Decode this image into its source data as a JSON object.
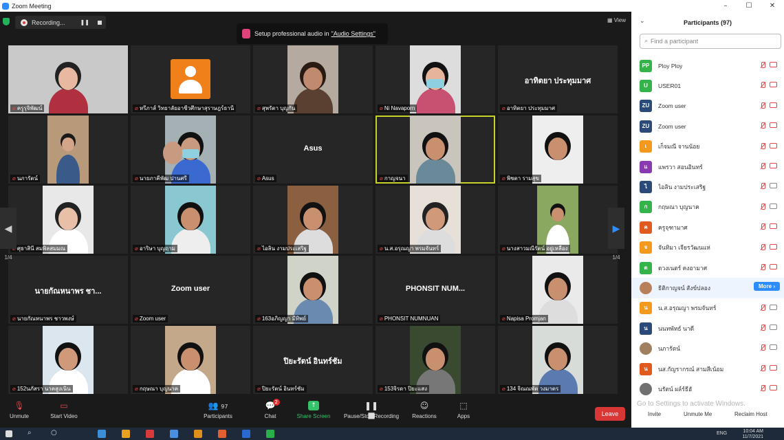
{
  "window": {
    "title": "Zoom Meeting",
    "controls": [
      "–",
      "☐",
      "✕"
    ]
  },
  "recording": {
    "label": "Recording...",
    "pause": "❚❚"
  },
  "audio_banner": {
    "text": "Setup professional audio in ",
    "link": "\"Audio Settings\""
  },
  "view_label": "View",
  "pager": {
    "left_num": "1/4",
    "right_num": "1/4"
  },
  "tiles": [
    {
      "name": "ครูรุจิพัฒน์",
      "video": "face",
      "bg": "#c9c9c9",
      "skin": "#e8b8a0",
      "hair": "#222",
      "shirt": "#b03040"
    },
    {
      "name": "หรีภาส์ วิทยาลัยอาชีวศึกษาสุราษฎร์ธานี",
      "video": "avatar"
    },
    {
      "name": "สุพรัตา บุญกัน",
      "video": "face",
      "bg": "#b5aaa0",
      "skin": "#c08a6e",
      "hair": "#2a1a14",
      "shirt": "#5a4030"
    },
    {
      "name": "Ni Navaporn",
      "video": "face",
      "bg": "#ddd",
      "skin": "#e6b49a",
      "hair": "#111",
      "shirt": "#c85070",
      "mask": true
    },
    {
      "name": "อาทิตยา ประทุมมาศ",
      "video": "text",
      "big": "อาทิตยา ประทุมมาศ"
    },
    {
      "name": "นภารัตน์",
      "video": "face",
      "bg": "#b89a7a",
      "skin": "#d5a58a",
      "hair": "#1a1a1a",
      "shirt": "#3a5a8a",
      "small": true
    },
    {
      "name": "นายภาคีพัฒ ปานศรี",
      "video": "face2",
      "bg": "#a5b0b5",
      "skin": "#c89a80",
      "hair": "#111",
      "shirt": "#3a6ad0",
      "mask": true
    },
    {
      "name": "Asus",
      "video": "text",
      "big": "Asus"
    },
    {
      "name": "กาญจนา",
      "video": "face",
      "bg": "#c9c5bc",
      "skin": "#c8906e",
      "hair": "#111",
      "shirt": "#6a8a9a",
      "active": true
    },
    {
      "name": "พิชตา รามสุข",
      "video": "face",
      "bg": "#eee",
      "skin": "#c8906e",
      "hair": "#111",
      "shirt": "#eee"
    },
    {
      "name": "ศุธาสินี สมพิลสมมณ",
      "video": "face",
      "bg": "#e8e8e8",
      "skin": "#e8c0a8",
      "hair": "#222",
      "shirt": "#fff"
    },
    {
      "name": "อาริษา บุญฤาม",
      "video": "face",
      "bg": "#89c8d0",
      "skin": "#c8906e",
      "hair": "#111",
      "shirt": "#eee"
    },
    {
      "name": "ไอลิน งามประเสริฐ",
      "video": "face",
      "bg": "#8a6040",
      "skin": "#c8906e",
      "hair": "#111",
      "shirt": "#ddd"
    },
    {
      "name": "น.ส.อรุณญา พรมจันทร์",
      "video": "face",
      "bg": "#e6e0d8",
      "skin": "#d09a7a",
      "hair": "#222",
      "shirt": "#ddd"
    },
    {
      "name": "นางสาวมณีรัตน์ อยู่เหลือง",
      "video": "face",
      "bg": "#8aa860",
      "skin": "#c8906e",
      "hair": "#111",
      "shirt": "#fff",
      "small": true
    },
    {
      "name": "นายกัณหนาพร ชาวพงษ์",
      "video": "text",
      "big": "นายกัณหนาพร ชา..."
    },
    {
      "name": "Zoom user",
      "video": "text",
      "big": "Zoom user"
    },
    {
      "name": "163อภิญญา มีทิพย์",
      "video": "face",
      "bg": "#d0d4c8",
      "skin": "#c8906e",
      "hair": "#111",
      "shirt": "#6a8ab0"
    },
    {
      "name": "PHONSIT NUMNUAN",
      "video": "text",
      "big": "PHONSIT NUM..."
    },
    {
      "name": "Napisa Promjan",
      "video": "face",
      "bg": "#eaeaea",
      "skin": "#c8906e",
      "hair": "#111",
      "shirt": "#ddd"
    },
    {
      "name": "152นภัสรา นาคสูงเนิน",
      "video": "face",
      "bg": "#dce6ee",
      "skin": "#d09a7a",
      "hair": "#111",
      "shirt": "#fff"
    },
    {
      "name": "กฤษณา บุญนาค",
      "video": "face",
      "bg": "#c4a88a",
      "skin": "#c8906e",
      "hair": "#111",
      "shirt": "#fff"
    },
    {
      "name": "ปิยะรัตน์ อินทร์ชัม",
      "video": "text",
      "big": "ปิยะรัตน์ อินทร์ชัม"
    },
    {
      "name": "153จิรดา ปิยะแสง",
      "video": "face",
      "bg": "#3a4a30",
      "skin": "#c8906e",
      "hair": "#111",
      "shirt": "#777"
    },
    {
      "name": "134 จิณณพัต วงมาตร",
      "video": "face",
      "bg": "#d8dcd8",
      "skin": "#c8906e",
      "hair": "#111",
      "shirt": "#5a7ab0"
    }
  ],
  "toolbar": {
    "unmute": "Unmute",
    "start_video": "Start Video",
    "participants": "Participants",
    "participants_count": "97",
    "chat": "Chat",
    "chat_badge": "2",
    "share": "Share Screen",
    "record": "Pause/Stop Recording",
    "reactions": "Reactions",
    "apps": "Apps",
    "leave": "Leave"
  },
  "panel": {
    "title": "Participants (97)",
    "search_placeholder": "Find a participant",
    "participants": [
      {
        "initials": "PP",
        "name": "Ploy Ploy",
        "color": "#33b34a",
        "cam": "red"
      },
      {
        "initials": "U",
        "name": "USER01",
        "color": "#33b34a",
        "cam": "red"
      },
      {
        "initials": "ZU",
        "name": "Zoom user",
        "color": "#2b4a7a",
        "cam": "red"
      },
      {
        "initials": "ZU",
        "name": "Zoom user",
        "color": "#2b4a7a",
        "cam": "red"
      },
      {
        "initials": "เ",
        "name": "เก็จมณี จานน้อย",
        "color": "#f39a1e",
        "cam": "red"
      },
      {
        "initials": "แ",
        "name": "แพรวา สอนอินทร์",
        "color": "#8a3ab0",
        "cam": "red"
      },
      {
        "initials": "ไ",
        "name": "ไอลิน งามประเสริฐ",
        "color": "#2b4a7a",
        "cam": "gray"
      },
      {
        "initials": "ก",
        "name": "กฤษณา บุญนาค",
        "color": "#33b34a",
        "cam": "gray"
      },
      {
        "initials": "ค",
        "name": "ครูจุฑามาศ",
        "color": "#e05a20",
        "cam": "red"
      },
      {
        "initials": "จ",
        "name": "จันทิมา เจียรวัฒนแห่",
        "color": "#f39a1e",
        "cam": "red"
      },
      {
        "initials": "ต",
        "name": "ดวงเนตร์ คงอามาศ",
        "color": "#33b34a",
        "cam": "red"
      },
      {
        "initials": "",
        "name": "ธิติกาญจน์ สังข์ปลอง",
        "color": "#b8805a",
        "cam": "more",
        "photo": true
      },
      {
        "initials": "น",
        "name": "น.ส.อรุณญา พรมจันทร์",
        "color": "#f39a1e",
        "cam": "gray"
      },
      {
        "initials": "น",
        "name": "นนทพัทธ์ นาดี",
        "color": "#2b4a7a",
        "cam": "gray"
      },
      {
        "initials": "",
        "name": "นภารัตน์",
        "color": "#a08060",
        "cam": "gray",
        "photo": true
      },
      {
        "initials": "น",
        "name": "นส.กัญรากรณ์ สามสีเน้อม",
        "color": "#e05a20",
        "cam": "red"
      },
      {
        "initials": "",
        "name": "นรัตน์ ผล์ร์ธีฮั",
        "color": "#707070",
        "cam": "red",
        "photo": true
      }
    ],
    "more_label": "More ›",
    "watermark1": "Activate Windows",
    "watermark2": "Go to Settings to activate Windows.",
    "footer": {
      "invite": "Invite",
      "unmute_me": "Unmute Me",
      "reclaim": "Reclaim Host"
    }
  },
  "taskbar": {
    "lang": "ENG",
    "time": "10:04 AM",
    "date": "11/7/2021",
    "apps": [
      "#3a8fd8",
      "#e8a020",
      "#d83a3a",
      "#4a8fe0",
      "#e0901a",
      "#e06030",
      "#2a6ad0",
      "#2ab04a"
    ]
  }
}
